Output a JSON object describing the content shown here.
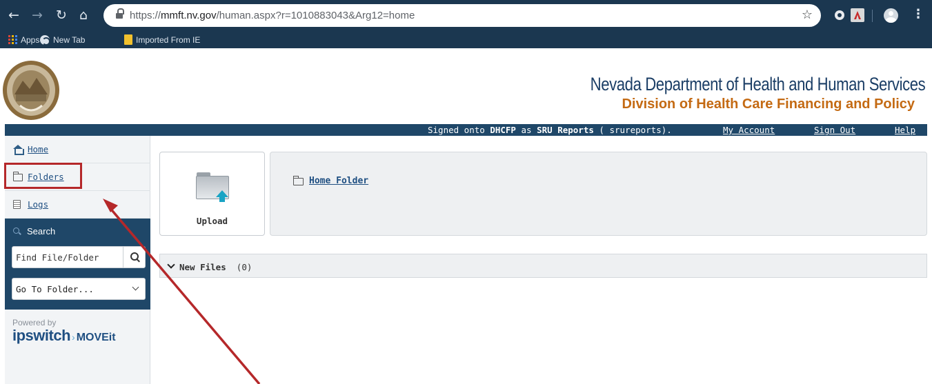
{
  "browser": {
    "url_scheme": "https://",
    "url_host": "mmft.nv.gov",
    "url_path": "/human.aspx?r=1010883043&Arg12=home",
    "bookmarks": [
      {
        "label": "Apps",
        "icon": "apps-grid-icon"
      },
      {
        "label": "New Tab",
        "icon": "globe-icon"
      },
      {
        "label": "Imported From IE",
        "icon": "bookmark-folder-icon"
      }
    ]
  },
  "header": {
    "dept_title": "Nevada Department of Health and Human Services",
    "division_title": "Division of Health Care Financing and Policy"
  },
  "user_bar": {
    "signed_prefix": "Signed onto",
    "org": "DHCFP",
    "as_text": "as",
    "user_name": "SRU Reports",
    "user_id": "( srureports).",
    "my_account": "My Account",
    "sign_out": "Sign Out",
    "help": "Help"
  },
  "sidebar": {
    "items": [
      {
        "label": "Home",
        "icon": "home-icon"
      },
      {
        "label": "Folders",
        "icon": "folder-icon"
      },
      {
        "label": "Logs",
        "icon": "logs-icon"
      }
    ],
    "search": {
      "title": "Search",
      "find_placeholder": "Find File/Folder",
      "goto_label": "Go To Folder..."
    },
    "powered_by": "Powered by",
    "brand_ipswitch": "ipswitch",
    "brand_moveit": "MOVEit"
  },
  "main": {
    "upload_label": "Upload",
    "home_folder_link": "Home Folder",
    "new_files_label": "New Files",
    "new_files_count": "(0)"
  },
  "colors": {
    "chrome_bg": "#1b3750",
    "site_navy": "#1f4768",
    "dept_title": "#1b3e66",
    "division_title": "#c46a13",
    "annotation_red": "#b5282a"
  }
}
